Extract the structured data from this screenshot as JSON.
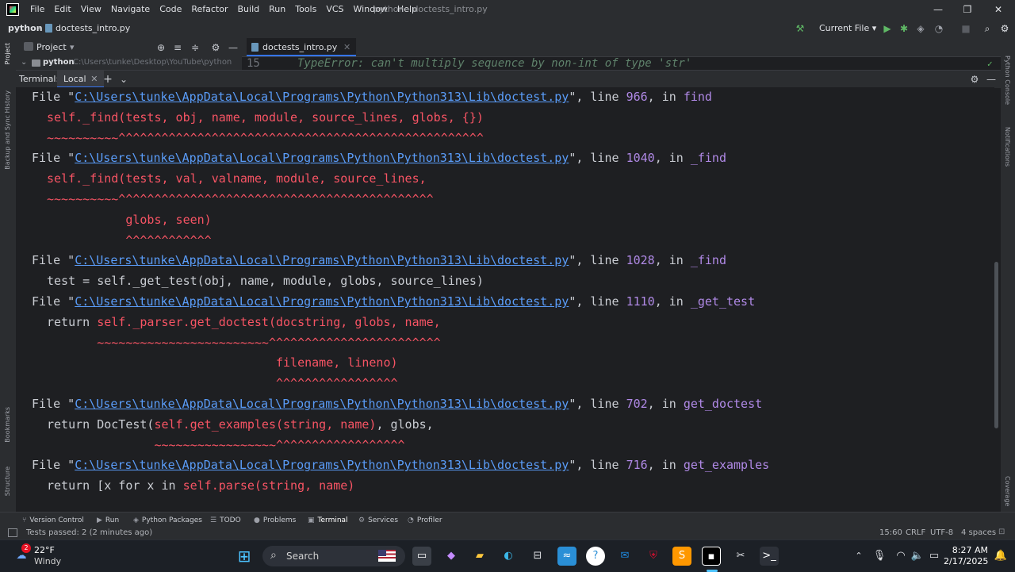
{
  "menubar": {
    "items": [
      "File",
      "Edit",
      "View",
      "Navigate",
      "Code",
      "Refactor",
      "Build",
      "Run",
      "Tools",
      "VCS",
      "Window",
      "Help"
    ],
    "title": "python - doctests_intro.py",
    "minimize": "—",
    "maximize": "❐",
    "close": "✕"
  },
  "navbar": {
    "project": "python",
    "separator": "›",
    "file": "doctests_intro.py",
    "run_config": "Current File"
  },
  "project_panel": {
    "title": "Project",
    "root_label": "python",
    "root_path": "C:\\Users\\tunke\\Desktop\\YouTube\\python"
  },
  "editor": {
    "tab": "doctests_intro.py",
    "line_number": "15",
    "line_text": "TypeError: can't multiply sequence by non-int of type 'str'"
  },
  "terminal": {
    "title": "Terminal:",
    "tab": "Local",
    "path": "C:\\Users\\tunke\\AppData\\Local\\Programs\\Python\\Python313\\Lib\\doctest.py",
    "lines": [
      {
        "file": true,
        "line": "966",
        "fn": "find"
      },
      {
        "code_red": "self._find(tests, obj, name, module, source_lines, globs, {})"
      },
      {
        "wave": "~~~~~~~~~~^^^^^^^^^^^^^^^^^^^^^^^^^^^^^^^^^^^^^^^^^^^^^^^^^^^"
      },
      {
        "file": true,
        "line": "1040",
        "fn": "_find"
      },
      {
        "code_red": "self._find(tests, val, valname, module, source_lines,"
      },
      {
        "wave": "~~~~~~~~~~^^^^^^^^^^^^^^^^^^^^^^^^^^^^^^^^^^^^^^^^^^^^"
      },
      {
        "code_red": "           globs, seen)"
      },
      {
        "wave": "           ^^^^^^^^^^^^"
      },
      {
        "file": true,
        "line": "1028",
        "fn": "_find"
      },
      {
        "code_plain": "test = self._get_test(obj, name, module, globs, source_lines)"
      },
      {
        "file": true,
        "line": "1110",
        "fn": "_get_test"
      },
      {
        "code_mixed_pre": "return ",
        "code_mixed_red": "self._parser.get_doctest(docstring, globs, name,"
      },
      {
        "wave": "       ~~~~~~~~~~~~~~~~~~~~~~~~^^^^^^^^^^^^^^^^^^^^^^^^"
      },
      {
        "code_red": "                                filename, lineno)"
      },
      {
        "wave": "                                ^^^^^^^^^^^^^^^^^"
      },
      {
        "file": true,
        "line": "702",
        "fn": "get_doctest"
      },
      {
        "code_mixed_pre": "return DocTest(",
        "code_mixed_red": "self.get_examples(string, name)",
        "code_mixed_post": ", globs,"
      },
      {
        "wave": "               ~~~~~~~~~~~~~~~~~^^^^^^^^^^^^^^^^^^"
      },
      {
        "file": true,
        "line": "716",
        "fn": "get_examples"
      },
      {
        "code_mixed_pre": "return [x for x in ",
        "code_mixed_red": "self.parse(string, name)"
      }
    ],
    "file_prefix": "File \"",
    "line_mid": "\", line ",
    "in_mid": ", in "
  },
  "bottom_tools": [
    "Version Control",
    "Run",
    "Python Packages",
    "TODO",
    "Problems",
    "Terminal",
    "Services",
    "Profiler"
  ],
  "status": {
    "message": "Tests passed: 2 (2 minutes ago)",
    "position": "15:60",
    "line_sep": "CRLF",
    "encoding": "UTF-8",
    "indent": "4 spaces"
  },
  "left_labels": [
    "Project",
    "Backup and Sync History",
    "Bookmarks",
    "Structure"
  ],
  "right_labels": [
    "Python Console",
    "Notifications",
    "Coverage"
  ],
  "taskbar": {
    "weather_temp": "22°F",
    "weather_desc": "Windy",
    "weather_badge": "2",
    "search": "Search",
    "time": "8:27 AM",
    "date": "2/17/2025"
  }
}
